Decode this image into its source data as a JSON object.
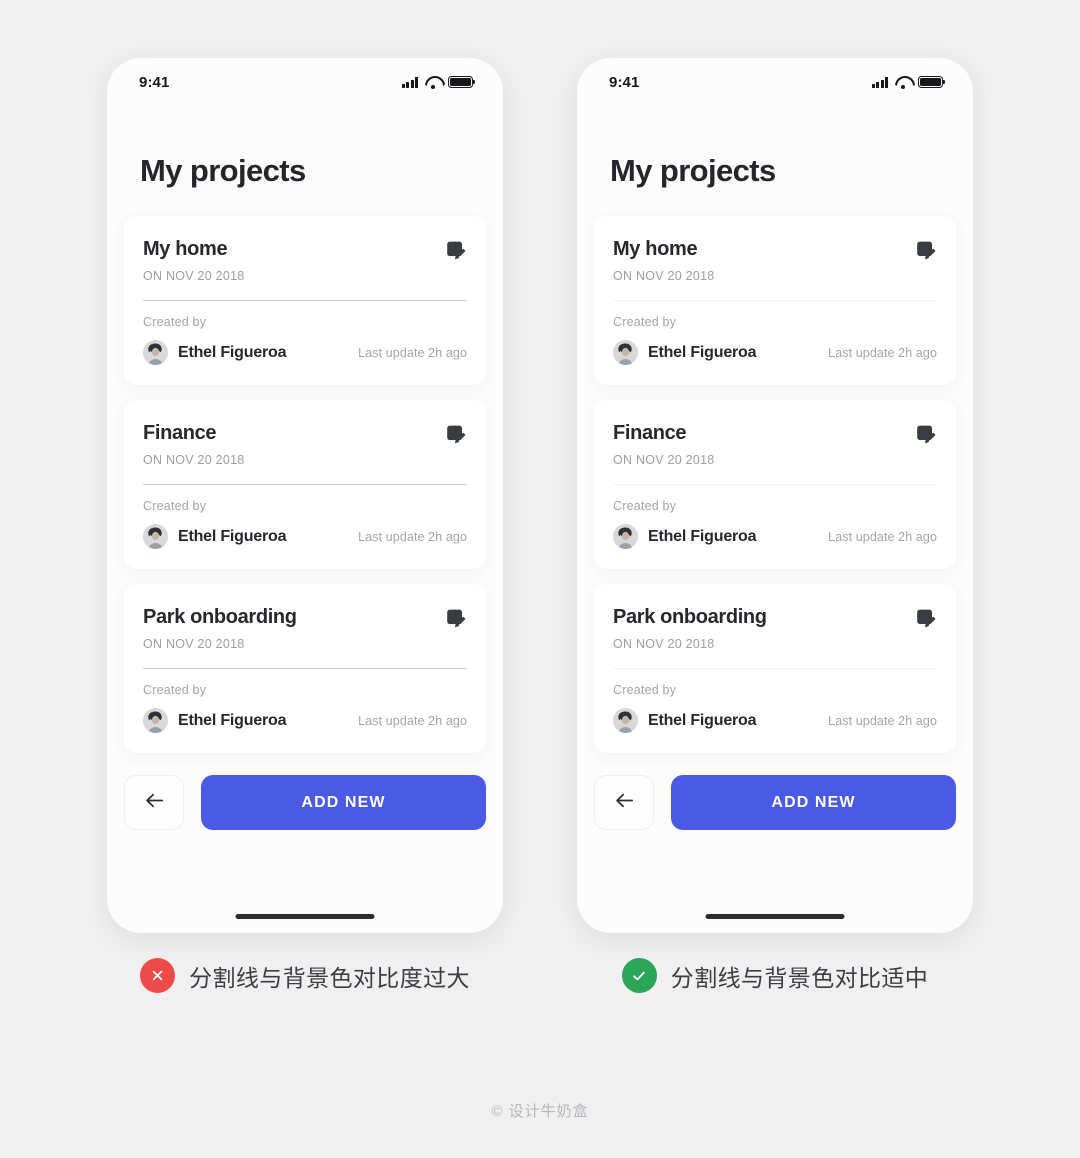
{
  "page": {
    "background_color": "#f0f0f0",
    "watermark": "© 设计牛奶盒"
  },
  "status_bar": {
    "time": "9:41",
    "icons": [
      "signal-icon",
      "wifi-icon",
      "battery-icon"
    ]
  },
  "screen": {
    "title": "My projects"
  },
  "cards": [
    {
      "title": "My home",
      "date": "ON NOV 20 2018",
      "edit_icon": "edit-pencil-icon",
      "meta_label": "Created by",
      "author": "Ethel Figueroa",
      "last_update": "Last update 2h ago"
    },
    {
      "title": "Finance",
      "date": "ON NOV 20 2018",
      "edit_icon": "edit-pencil-icon",
      "meta_label": "Created by",
      "author": "Ethel Figueroa",
      "last_update": "Last update 2h ago"
    },
    {
      "title": "Park onboarding",
      "date": "ON NOV 20 2018",
      "edit_icon": "edit-pencil-icon",
      "meta_label": "Created by",
      "author": "Ethel Figueroa",
      "last_update": "Last update 2h ago"
    }
  ],
  "actions": {
    "back_icon": "arrow-left-icon",
    "add_label": "ADD NEW",
    "add_color": "#4a5ae4"
  },
  "variants": {
    "left": {
      "divider_color": "#cdced2",
      "badge": {
        "type": "error-icon",
        "glyph": "✕",
        "color": "#ef4a4a"
      },
      "caption": "分割线与背景色对比度过大"
    },
    "right": {
      "divider_color": "#f3f3f5",
      "badge": {
        "type": "success-icon",
        "glyph": "✓",
        "color": "#2ba558"
      },
      "caption": "分割线与背景色对比适中"
    }
  }
}
